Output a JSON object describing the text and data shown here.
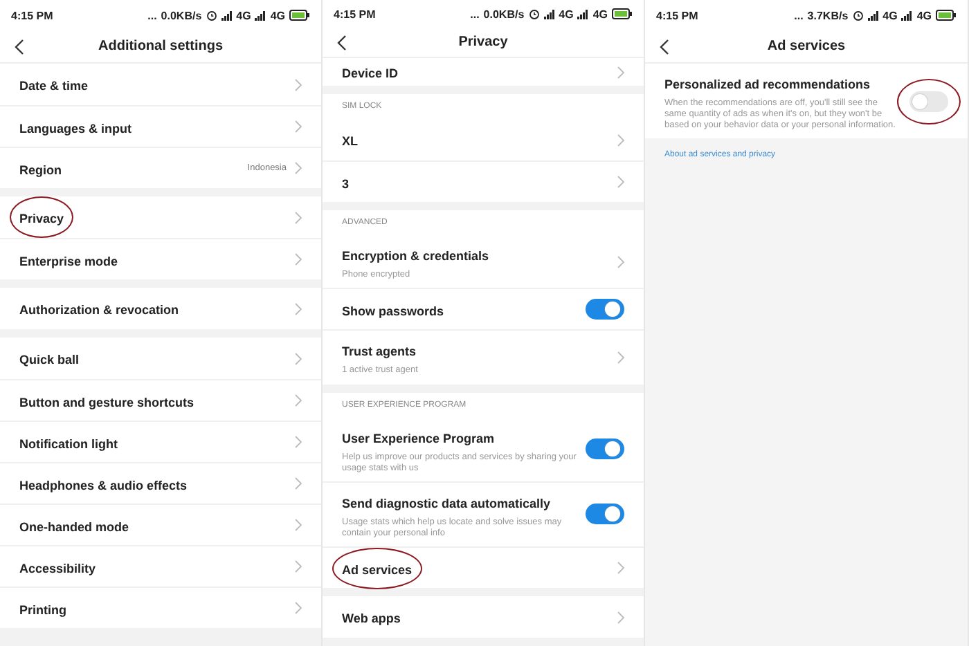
{
  "panels": [
    {
      "status_bar": {
        "time": "4:15 PM",
        "dots": "...",
        "speed": "0.0KB/s",
        "networks": [
          "4G",
          "4G"
        ]
      },
      "title": "Additional settings",
      "groups": [
        {
          "items": [
            {
              "kind": "link",
              "label": "Date & time"
            },
            {
              "kind": "link",
              "label": "Languages & input"
            },
            {
              "kind": "link",
              "label": "Region",
              "value": "Indonesia"
            }
          ]
        },
        {
          "items": [
            {
              "kind": "link",
              "label": "Privacy",
              "circled": true
            },
            {
              "kind": "link",
              "label": "Enterprise mode"
            }
          ]
        },
        {
          "items": [
            {
              "kind": "link",
              "label": "Authorization & revocation"
            }
          ]
        },
        {
          "items": [
            {
              "kind": "link",
              "label": "Quick ball"
            },
            {
              "kind": "link",
              "label": "Button and gesture shortcuts"
            },
            {
              "kind": "link",
              "label": "Notification light"
            },
            {
              "kind": "link",
              "label": "Headphones & audio effects"
            },
            {
              "kind": "link",
              "label": "One-handed mode"
            },
            {
              "kind": "link",
              "label": "Accessibility"
            },
            {
              "kind": "link",
              "label": "Printing"
            }
          ]
        }
      ]
    },
    {
      "status_bar": {
        "time": "4:15 PM",
        "dots": "...",
        "speed": "0.0KB/s",
        "networks": [
          "4G",
          "4G"
        ]
      },
      "title": "Privacy",
      "groups": [
        {
          "items": [
            {
              "kind": "partial",
              "label": "Device ID"
            }
          ]
        },
        {
          "title": "SIM LOCK",
          "items": [
            {
              "kind": "link",
              "label": "XL"
            },
            {
              "kind": "link",
              "label": "3"
            }
          ]
        },
        {
          "title": "ADVANCED",
          "items": [
            {
              "kind": "link",
              "label": "Encryption & credentials",
              "subtitle": "Phone encrypted"
            },
            {
              "kind": "toggle",
              "label": "Show passwords",
              "on": true
            },
            {
              "kind": "link",
              "label": "Trust agents",
              "subtitle": "1 active trust agent"
            }
          ]
        },
        {
          "title": "USER EXPERIENCE PROGRAM",
          "items": [
            {
              "kind": "toggle",
              "label": "User Experience Program",
              "subtitle": "Help us improve our products and services by sharing your usage stats with us",
              "on": true
            },
            {
              "kind": "toggle",
              "label": "Send diagnostic data automatically",
              "subtitle": "Usage stats which help us locate and solve issues may contain your personal info",
              "on": true
            },
            {
              "kind": "link",
              "label": "Ad services",
              "circled": true
            }
          ]
        },
        {
          "items": [
            {
              "kind": "link",
              "label": "Web apps"
            }
          ]
        }
      ]
    },
    {
      "status_bar": {
        "time": "4:15 PM",
        "dots": "...",
        "speed": "3.7KB/s",
        "networks": [
          "4G",
          "4G"
        ]
      },
      "title": "Ad services",
      "groups": [
        {
          "items": [
            {
              "kind": "toggle",
              "label": "Personalized ad recommendations",
              "subtitle": "When the recommendations are off, you'll still see the same quantity of ads as when it's on, but they won't be based on your behavior data or your personal information.",
              "on": false,
              "circled": true
            }
          ]
        }
      ],
      "footer_link": "About ad services and privacy"
    }
  ]
}
